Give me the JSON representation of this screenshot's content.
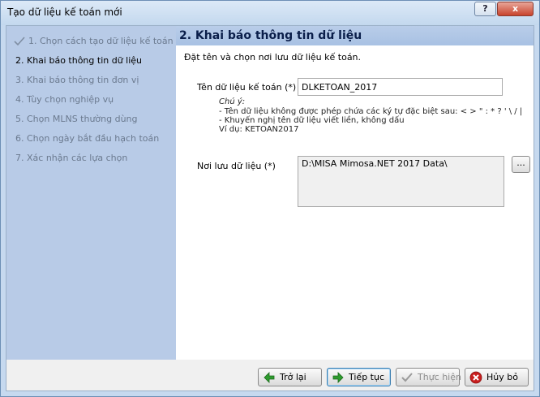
{
  "window": {
    "title": "Tạo dữ liệu kế toán mới",
    "help_label": "?",
    "close_label": "x"
  },
  "steps": [
    {
      "label": "1. Chọn cách tạo dữ liệu kế toán",
      "state": "done"
    },
    {
      "label": "2. Khai báo thông tin dữ liệu",
      "state": "active"
    },
    {
      "label": "3. Khai báo thông tin đơn vị",
      "state": "pending"
    },
    {
      "label": "4. Tùy chọn nghiệp vụ",
      "state": "pending"
    },
    {
      "label": "5. Chọn MLNS thường dùng",
      "state": "pending"
    },
    {
      "label": "6. Chọn ngày bắt đầu hạch toán",
      "state": "pending"
    },
    {
      "label": "7. Xác nhận các lựa chọn",
      "state": "pending"
    }
  ],
  "main": {
    "section_title": "2. Khai báo thông tin dữ liệu",
    "description": "Đặt tên và chọn nơi lưu dữ liệu kế toán.",
    "name_label": "Tên dữ liệu kế toán (*)",
    "name_value": "DLKETOAN_2017",
    "note": {
      "heading": "Chú ý:",
      "line1": "- Tên dữ liệu không được phép chứa các ký tự đặc biệt sau: < > \" : * ? ' \\ / |",
      "line2": "- Khuyến nghị tên dữ liệu viết liền, không dấu",
      "line3": "Ví dụ: KETOAN2017"
    },
    "location_label": "Nơi lưu dữ liệu (*)",
    "location_value": "D:\\MISA Mimosa.NET 2017 Data\\",
    "browse_label": "..."
  },
  "footer": {
    "back_label": "Trở lại",
    "next_label": "Tiếp tục",
    "finish_label": "Thực hiện",
    "cancel_label": "Hủy bỏ"
  },
  "colors": {
    "sidebar_bg": "#b8cbe7",
    "header_bg": "#a8c1e3",
    "title_text": "#0a1e4a",
    "back_icon": "#2e9b2e",
    "next_icon": "#2e9b2e",
    "cancel_icon": "#c81e1e"
  }
}
